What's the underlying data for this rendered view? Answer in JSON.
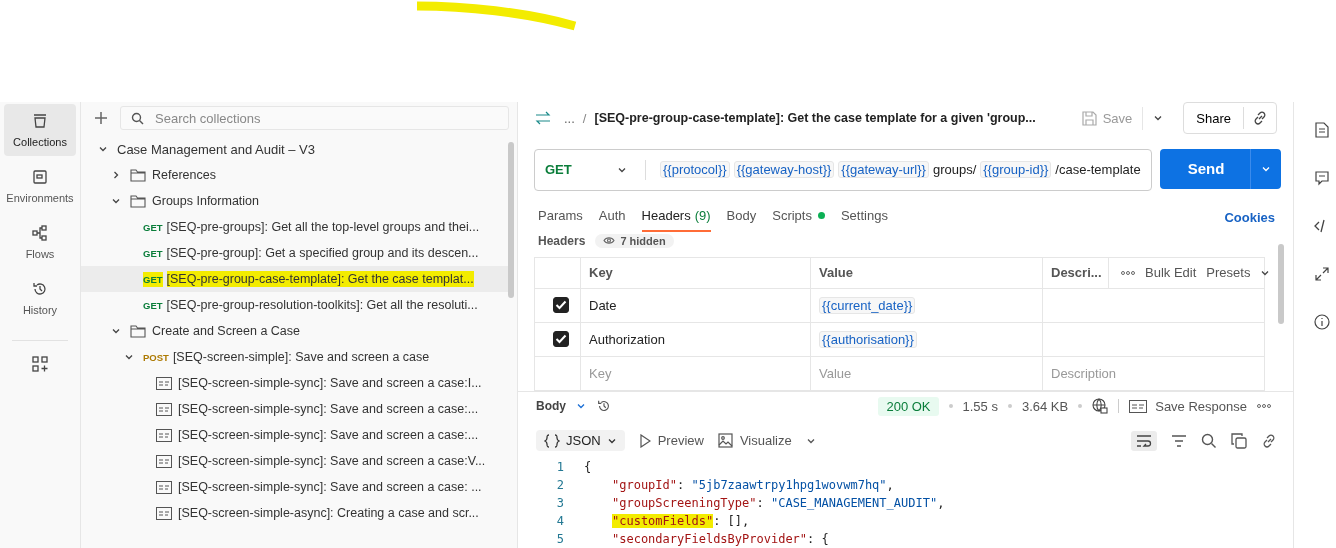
{
  "rail": {
    "items": [
      {
        "kind": "collections",
        "label": "Collections",
        "selected": true
      },
      {
        "kind": "environments",
        "label": "Environments",
        "selected": false
      },
      {
        "kind": "flows",
        "label": "Flows",
        "selected": false
      },
      {
        "kind": "history",
        "label": "History",
        "selected": false
      }
    ]
  },
  "sidebar": {
    "search": {
      "placeholder": "Search collections"
    },
    "tree": [
      {
        "kind": "collection",
        "label": "Case Management and Audit – V3",
        "expanded": true,
        "children": [
          {
            "kind": "folder",
            "label": "References",
            "expanded": false
          },
          {
            "kind": "folder",
            "label": "Groups Information",
            "expanded": true,
            "children": [
              {
                "kind": "request",
                "method": "GET",
                "label": "[SEQ-pre-groups]: Get all the top-level groups and thei...",
                "selected": false,
                "highlighted": false
              },
              {
                "kind": "request",
                "method": "GET",
                "label": "[SEQ-pre-group]: Get a specified group and its descen...",
                "selected": false,
                "highlighted": false
              },
              {
                "kind": "request",
                "method": "GET",
                "label": "[SEQ-pre-group-case-template]: Get the case templat...",
                "selected": true,
                "highlighted": true
              },
              {
                "kind": "request",
                "method": "GET",
                "label": "[SEQ-pre-group-resolution-toolkits]: Get all the resoluti...",
                "selected": false,
                "highlighted": false
              }
            ]
          },
          {
            "kind": "folder",
            "label": "Create and Screen a Case",
            "expanded": true,
            "children": [
              {
                "kind": "request",
                "method": "POST",
                "label": "[SEQ-screen-simple]: Save and screen a case",
                "selected": false,
                "highlighted": false,
                "expanded": true,
                "children": [
                  {
                    "kind": "example",
                    "label": "[SEQ-screen-simple-sync]: Save and screen a case:I..."
                  },
                  {
                    "kind": "example",
                    "label": "[SEQ-screen-simple-sync]: Save and screen a case:..."
                  },
                  {
                    "kind": "example",
                    "label": "[SEQ-screen-simple-sync]: Save and screen a case:..."
                  },
                  {
                    "kind": "example",
                    "label": "[SEQ-screen-simple-sync]: Save and screen a case:V..."
                  },
                  {
                    "kind": "example",
                    "label": "[SEQ-screen-simple-sync]: Save and screen a case: ..."
                  },
                  {
                    "kind": "example",
                    "label": "[SEQ-screen-simple-async]: Creating a case and scr..."
                  }
                ]
              }
            ]
          }
        ]
      }
    ]
  },
  "request": {
    "breadcrumb": "...",
    "separator": "/",
    "title": "[SEQ-pre-group-case-template]: Get the case template for a given 'group...",
    "save": "Save",
    "share": "Share",
    "method": "GET",
    "url": [
      {
        "kind": "var",
        "text": "{{protocol}}"
      },
      {
        "kind": "var",
        "text": "{{gateway-host}}"
      },
      {
        "kind": "var",
        "text": "{{gateway-url}}"
      },
      {
        "kind": "text",
        "text": "groups/"
      },
      {
        "kind": "var",
        "text": "{{group-id}}"
      },
      {
        "kind": "text",
        "text": "/case-template"
      }
    ],
    "send": "Send",
    "tabs": [
      {
        "label": "Params",
        "selected": false
      },
      {
        "label": "Auth",
        "selected": false
      },
      {
        "label": "Headers",
        "count": "(9)",
        "selected": true
      },
      {
        "label": "Body",
        "selected": false
      },
      {
        "label": "Scripts",
        "dot": true,
        "selected": false
      },
      {
        "label": "Settings",
        "selected": false
      }
    ],
    "cookies": "Cookies"
  },
  "headers": {
    "label": "Headers",
    "hidden": "7 hidden",
    "columns": [
      "Key",
      "Value",
      "Descri..."
    ],
    "bulk_edit": "Bulk Edit",
    "presets": "Presets",
    "rows": [
      {
        "checked": true,
        "key": "Date",
        "value": "{{current_date}}"
      },
      {
        "checked": true,
        "key": "Authorization",
        "value": "{{authorisation}}"
      }
    ],
    "placeholder": {
      "key": "Key",
      "value": "Value",
      "description": "Description"
    }
  },
  "response": {
    "section": "Body",
    "status": "200 OK",
    "time": "1.55 s",
    "size": "3.64 KB",
    "save_response": "Save Response",
    "format": "JSON",
    "preview": "Preview",
    "visualize": "Visualize",
    "lines": [
      {
        "number": "1",
        "indented": false,
        "tokens": [
          {
            "kind": "punct",
            "text": "{"
          }
        ]
      },
      {
        "number": "2",
        "indented": true,
        "tokens": [
          {
            "kind": "key",
            "text": "\"groupId\""
          },
          {
            "kind": "punct",
            "text": ": "
          },
          {
            "kind": "string",
            "text": "\"5jb7zaawtrpy1hpg1wovwm7hq\""
          },
          {
            "kind": "punct",
            "text": ","
          }
        ]
      },
      {
        "number": "3",
        "indented": true,
        "tokens": [
          {
            "kind": "key",
            "text": "\"groupScreeningType\""
          },
          {
            "kind": "punct",
            "text": ": "
          },
          {
            "kind": "string",
            "text": "\"CASE_MANAGEMENT_AUDIT\""
          },
          {
            "kind": "punct",
            "text": ","
          }
        ]
      },
      {
        "number": "4",
        "indented": true,
        "tokens": [
          {
            "kind": "key",
            "text": "\"customFields\"",
            "marked": true
          },
          {
            "kind": "punct",
            "text": ": [],"
          }
        ]
      },
      {
        "number": "5",
        "indented": true,
        "tokens": [
          {
            "kind": "key",
            "text": "\"secondaryFieldsByProvider\""
          },
          {
            "kind": "punct",
            "text": ": {"
          }
        ]
      }
    ]
  }
}
